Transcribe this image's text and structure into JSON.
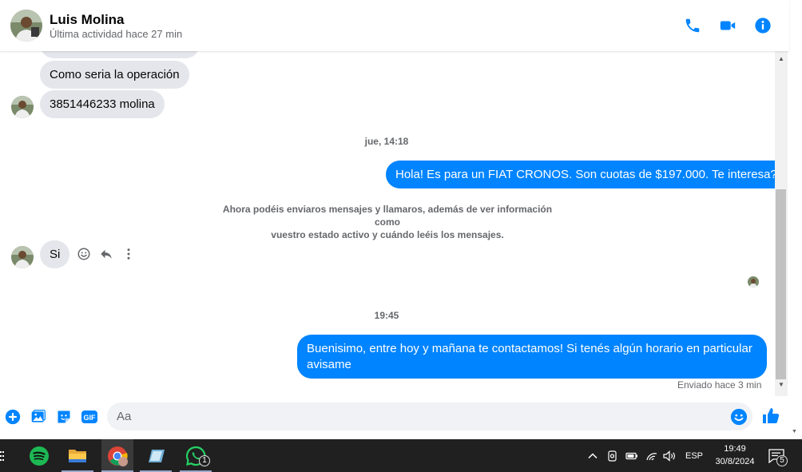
{
  "header": {
    "name": "Luis Molina",
    "status": "Última actividad hace 27 min",
    "icons": [
      "phone-icon",
      "video-icon",
      "info-icon"
    ],
    "accent_color": "#0084ff"
  },
  "messages": {
    "incoming_1": "Como seria la operación",
    "incoming_2": "3851446233 molina",
    "time_1": "jue, 14:18",
    "outgoing_1": "Hola! Es para un FIAT CRONOS. Son cuotas de $197.000. Te interesa?",
    "notice_line1": "Ahora podéis enviaros mensajes y llamaros, además de ver información como",
    "notice_line2": "vuestro estado activo y cuándo leéis los mensajes.",
    "incoming_3": "Si",
    "time_2": "19:45",
    "outgoing_2": "Buenisimo, entre hoy y mañana te contactamos! Si tenés algún horario en particular avisame",
    "sent_status": "Enviado hace 3 min"
  },
  "composer": {
    "placeholder": "Aa",
    "gif_label": "GIF",
    "icons": [
      "plus-icon",
      "image-icon",
      "sticker-icon",
      "gif-icon",
      "emoji-icon",
      "thumbs-up-icon"
    ]
  },
  "taskbar": {
    "apps": [
      "spotify",
      "file-explorer",
      "chrome",
      "notes",
      "whatsapp"
    ],
    "whatsapp_badge": "1",
    "language": "ESP",
    "time": "19:49",
    "date": "30/8/2024",
    "notification_count": "5"
  }
}
